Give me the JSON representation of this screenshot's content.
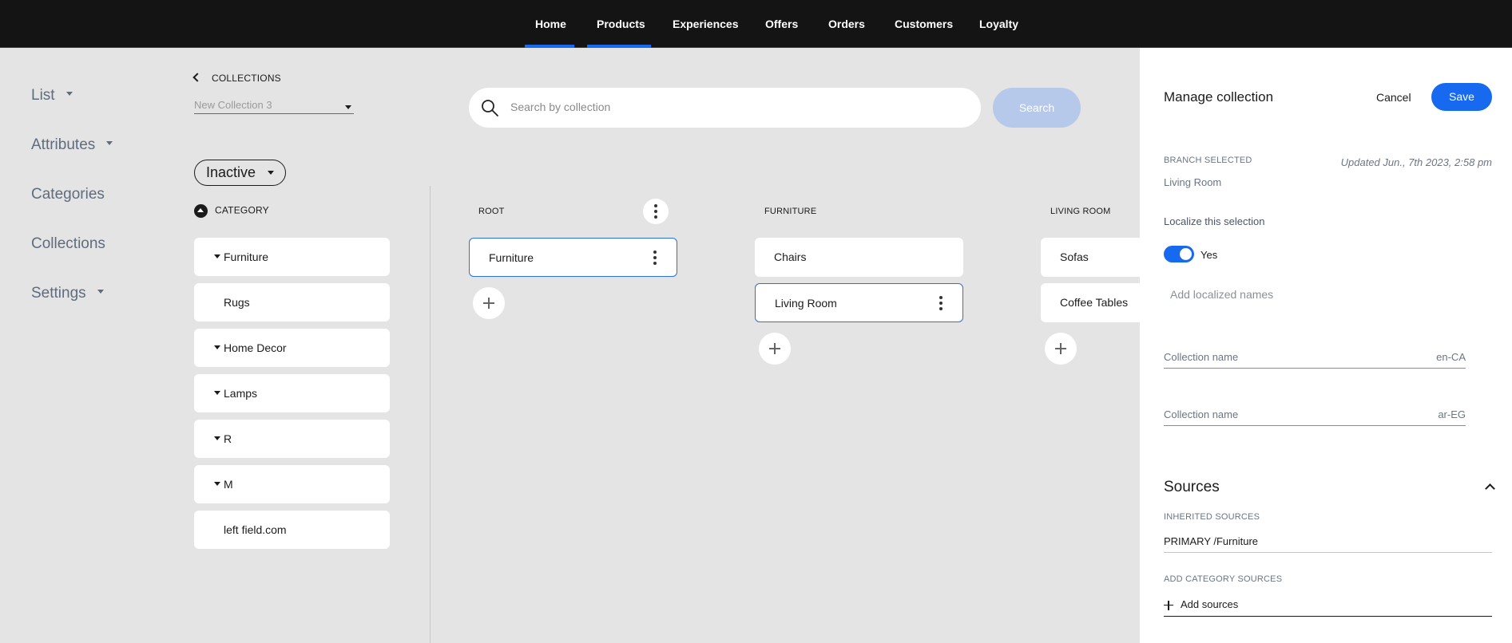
{
  "top_nav": {
    "items": [
      {
        "label": "Home"
      },
      {
        "label": "Products"
      },
      {
        "label": "Experiences"
      },
      {
        "label": "Offers"
      },
      {
        "label": "Orders"
      },
      {
        "label": "Customers"
      },
      {
        "label": "Loyalty"
      }
    ],
    "active": [
      "Home",
      "Products"
    ]
  },
  "sidebar": {
    "items": [
      {
        "label": "List"
      },
      {
        "label": "Attributes"
      },
      {
        "label": "Categories"
      },
      {
        "label": "Collections"
      },
      {
        "label": "Settings"
      }
    ]
  },
  "collections": {
    "back_label": "COLLECTIONS",
    "selected_collection": "New Collection 3",
    "status": "Inactive"
  },
  "search": {
    "placeholder": "Search by collection",
    "button_label": "Search"
  },
  "category_column": {
    "header": "CATEGORY",
    "items": [
      {
        "label": "Furniture"
      },
      {
        "label": "Rugs"
      },
      {
        "label": "Home Decor"
      },
      {
        "label": "Lamps"
      },
      {
        "label": "R"
      },
      {
        "label": "M"
      },
      {
        "label": "left field.com"
      }
    ]
  },
  "tree": {
    "columns": [
      {
        "header": "ROOT",
        "items": [
          {
            "label": "Furniture"
          }
        ]
      },
      {
        "header": "FURNITURE",
        "items": [
          {
            "label": "Chairs"
          },
          {
            "label": "Living Room"
          }
        ]
      },
      {
        "header": "LIVING ROOM",
        "items": [
          {
            "label": "Sofas"
          },
          {
            "label": "Coffee Tables"
          }
        ]
      }
    ]
  },
  "panel": {
    "title": "Manage collection",
    "cancel_label": "Cancel",
    "save_label": "Save",
    "branch_label": "BRANCH SELECTED",
    "branch_value": "Living Room",
    "updated": "Updated Jun., 7th 2023, 2:58 pm",
    "localize_label": "Localize this selection",
    "toggle_value": "Yes",
    "add_localized": "Add localized names",
    "fields": [
      {
        "label": "Collection name",
        "locale": "en-CA"
      },
      {
        "label": "Collection name",
        "locale": "ar-EG"
      }
    ],
    "sources_title": "Sources",
    "inherited_label": "INHERITED SOURCES",
    "inherited_value": "PRIMARY /Furniture",
    "add_category_label": "ADD CATEGORY SOURCES",
    "add_sources_label": "Add sources"
  },
  "colors": {
    "accent": "#1769f0",
    "topbar": "#141414",
    "background": "#e4e4e4"
  }
}
